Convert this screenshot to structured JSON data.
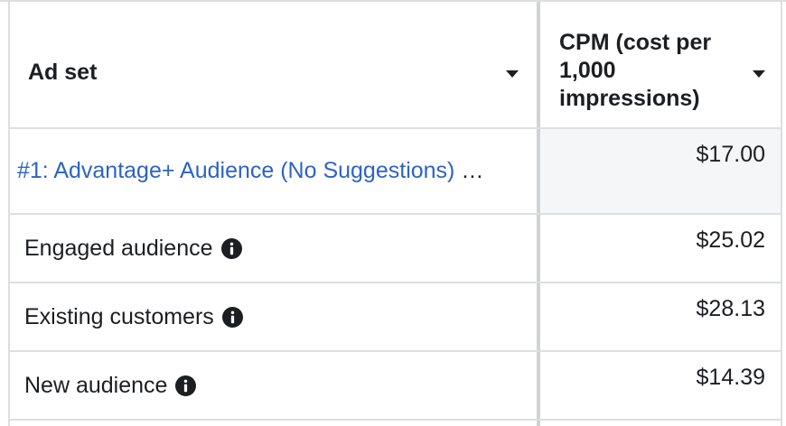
{
  "table": {
    "columns": [
      {
        "label": "Ad set"
      },
      {
        "label": "CPM (cost per 1,000 impressions)"
      }
    ],
    "rows": [
      {
        "name": "#1: Advantage+ Audience (No Suggestions)",
        "ellipsis": "…",
        "cpm": "$17.00",
        "info_icon": false
      },
      {
        "name": "Engaged audience",
        "cpm": "$25.02",
        "info_icon": true
      },
      {
        "name": "Existing customers",
        "cpm": "$28.13",
        "info_icon": true
      },
      {
        "name": "New audience",
        "cpm": "$14.39",
        "info_icon": true
      }
    ]
  },
  "colors": {
    "link": "#2d63c6",
    "text": "#1c1e21",
    "border": "#dddfe2",
    "highlight_bg": "#f5f6f7"
  },
  "icons": {
    "sort": "chevron-down-icon",
    "info": "info-icon"
  }
}
